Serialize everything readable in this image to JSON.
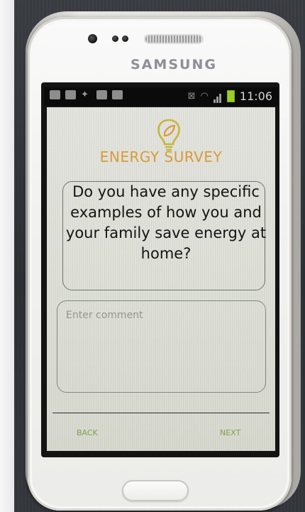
{
  "device": {
    "brand": "SAMSUNG"
  },
  "status_bar": {
    "time": "11:06",
    "battery_color": "#9ccc2a"
  },
  "app": {
    "title": "ENERGY SURVEY",
    "logo_icon": "energy-leaf-bulb-icon",
    "accent_color": "#d99b3a",
    "question": "Do you have any specific examples of how you and your family save energy at home?",
    "comment_placeholder": "Enter comment",
    "back_label": "BACK",
    "next_label": "NEXT",
    "nav_color": "#7ca34d"
  }
}
